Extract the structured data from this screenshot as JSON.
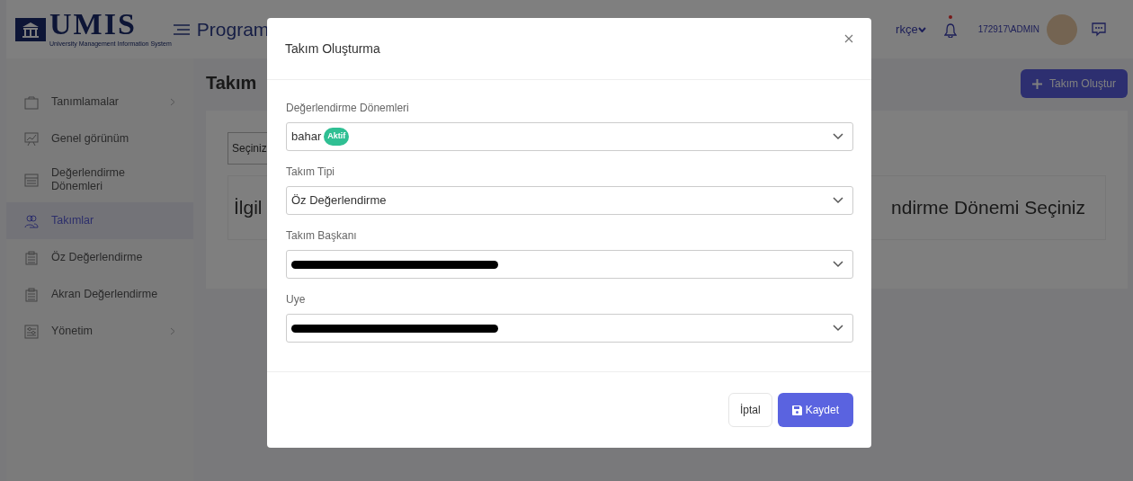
{
  "header": {
    "logo": {
      "title": "UMIS",
      "subtitle": "University Management Information System"
    },
    "page_title": "Program",
    "language": "rkçe",
    "notification_dot": true,
    "user": "172917\\ADMIN"
  },
  "sidebar": {
    "items": [
      {
        "label": "Tanımlamalar",
        "kind": "briefcase",
        "chevron": true,
        "selected": false
      },
      {
        "label": "Genel görünüm",
        "kind": "chart",
        "chevron": false,
        "selected": false
      },
      {
        "label": "Değerlendirme Dönemleri",
        "kind": "calendar",
        "chevron": false,
        "selected": false
      },
      {
        "label": "Takımlar",
        "kind": "people",
        "chevron": false,
        "selected": true
      },
      {
        "label": "Öz Değerlendirme",
        "kind": "clipboard",
        "chevron": false,
        "selected": false
      },
      {
        "label": "Akran Değerlendirme",
        "kind": "clipboard",
        "chevron": false,
        "selected": false
      },
      {
        "label": "Yönetim",
        "kind": "sliders",
        "chevron": true,
        "selected": false
      }
    ]
  },
  "content": {
    "title": "Takım",
    "create_button": "Takım Oluştur",
    "select": "Seçiniz",
    "message_left": "İlgil",
    "message_right": "ndirme Dönemi Seçiniz"
  },
  "modal": {
    "title": "Takım Oluşturma",
    "fields": [
      {
        "label": "Değerlendirme Dönemleri",
        "kind": "text",
        "value": "bahar",
        "badge": "Aktif"
      },
      {
        "label": "Takım Tipi",
        "kind": "text",
        "value": "Öz Değerlendirme"
      },
      {
        "label": "Takım Başkanı",
        "kind": "redacted"
      },
      {
        "label": "Uye",
        "kind": "redacted"
      }
    ],
    "buttons": [
      {
        "label": "İptal",
        "kind": "secondary"
      },
      {
        "label": "Kaydet",
        "kind": "primary"
      }
    ]
  }
}
